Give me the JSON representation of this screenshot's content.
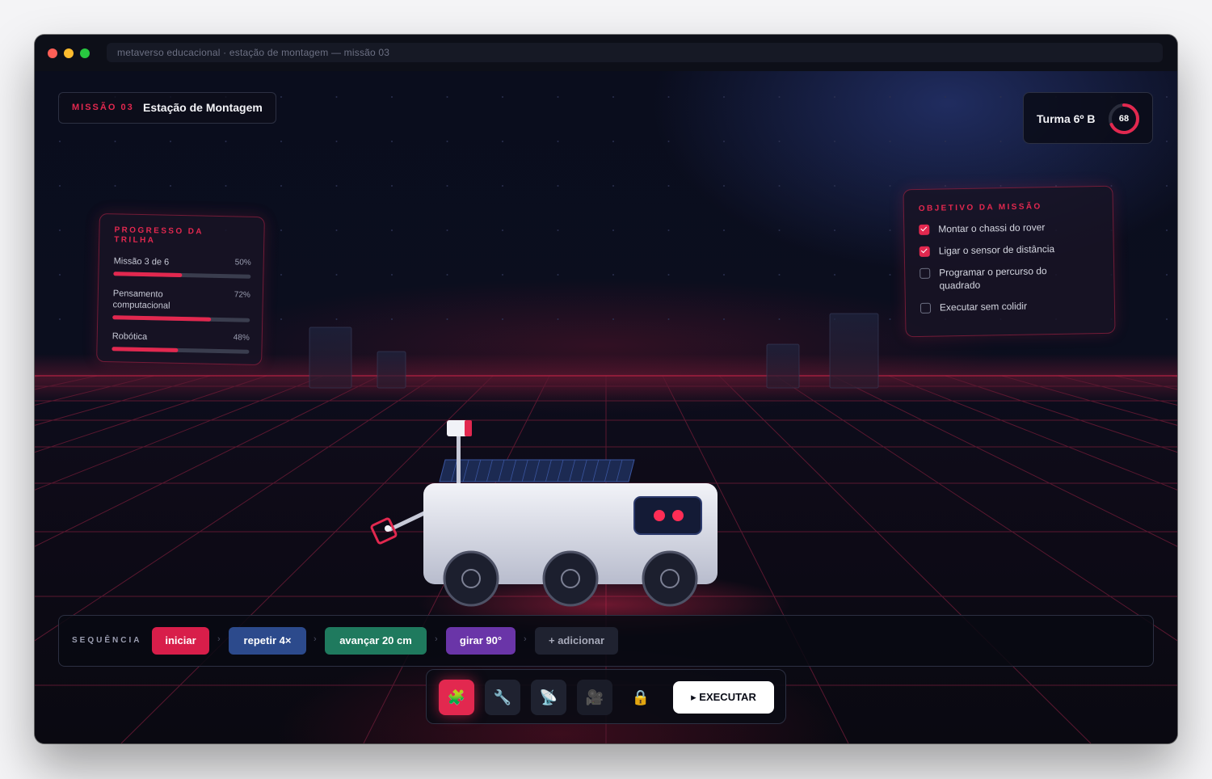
{
  "window": {
    "url": "metaverso educacional · estação de montagem — missão 03"
  },
  "mission": {
    "tag": "MISSÃO 03",
    "name": "Estação de Montagem"
  },
  "class_badge": {
    "label": "Turma 6º B",
    "score": "68",
    "score_fraction": 0.68
  },
  "progress": {
    "title": "PROGRESSO DA TRILHA",
    "rows": [
      {
        "label": "Missão 3 de 6",
        "percent_label": "50%",
        "value": 0.5
      },
      {
        "label": "Pensamento computacional",
        "percent_label": "72%",
        "value": 0.72
      },
      {
        "label": "Robótica",
        "percent_label": "48%",
        "value": 0.48
      }
    ]
  },
  "objective": {
    "title": "OBJETIVO DA MISSÃO",
    "items": [
      {
        "label": "Montar o chassi do rover",
        "checked": true
      },
      {
        "label": "Ligar o sensor de distância",
        "checked": true
      },
      {
        "label": "Programar o percurso do quadrado",
        "checked": false
      },
      {
        "label": "Executar sem colidir",
        "checked": false
      }
    ]
  },
  "sequence": {
    "label": "SEQUÊNCIA",
    "blocks": [
      {
        "label": "iniciar",
        "color": "#d81e4a"
      },
      {
        "label": "repetir 4×",
        "color": "#2c4a8c"
      },
      {
        "label": "avançar 20 cm",
        "color": "#1f7a5e"
      },
      {
        "label": "girar 90°",
        "color": "#6a35a8"
      },
      {
        "label": "+ adicionar",
        "color": "#1f2230"
      }
    ]
  },
  "toolbar": {
    "tools": [
      {
        "icon": "puzzle-icon",
        "glyph": "🧩",
        "active": true
      },
      {
        "icon": "wrench-icon",
        "glyph": "🔧",
        "active": false
      },
      {
        "icon": "satellite-antenna-icon",
        "glyph": "📡",
        "active": false
      },
      {
        "icon": "movie-camera-icon",
        "glyph": "🎥",
        "active": false,
        "disabled": true
      },
      {
        "icon": "lock-icon",
        "glyph": "🔒",
        "active": false,
        "disabled": true
      }
    ],
    "execute_label": "▸ EXECUTAR"
  },
  "colors": {
    "accent": "#e2284f",
    "background": "#0b0d18",
    "panel_border": "#2c3042"
  }
}
